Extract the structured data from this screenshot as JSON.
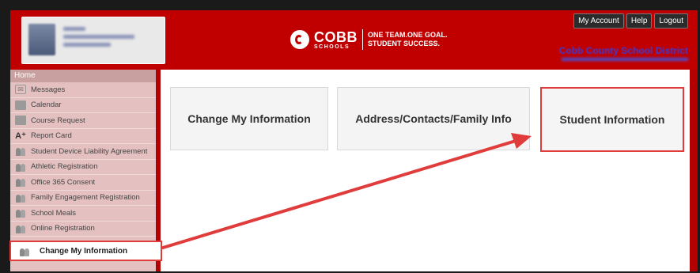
{
  "header": {
    "logo_word": "COBB",
    "logo_small": "SCHOOLS",
    "slogan_line1": "ONE TEAM.ONE GOAL.",
    "slogan_line2": "STUDENT SUCCESS.",
    "district": "Cobb County School District",
    "buttons": [
      "My Account",
      "Help",
      "Logout"
    ]
  },
  "sidebar": {
    "home": "Home",
    "items": [
      {
        "label": "Messages",
        "icon": "envelope-icon"
      },
      {
        "label": "Calendar",
        "icon": "calendar-icon"
      },
      {
        "label": "Course Request",
        "icon": "course-request-icon"
      },
      {
        "label": "Report Card",
        "icon": "report-card-icon"
      },
      {
        "label": "Student Device Liability Agreement",
        "icon": "people-icon"
      },
      {
        "label": "Athletic Registration",
        "icon": "people-icon"
      },
      {
        "label": "Office 365 Consent",
        "icon": "people-icon"
      },
      {
        "label": "Family Engagement Registration",
        "icon": "people-icon"
      },
      {
        "label": "School Meals",
        "icon": "people-icon"
      },
      {
        "label": "Online Registration",
        "icon": "people-icon"
      }
    ],
    "selected": "Change My Information"
  },
  "main": {
    "cards": [
      "Change My Information",
      "Address/Contacts/Family Info",
      "Student Information"
    ]
  },
  "colors": {
    "header_red": "#c00000",
    "highlight": "#e03c3c",
    "sidebar_bg": "#e4c0c0"
  }
}
